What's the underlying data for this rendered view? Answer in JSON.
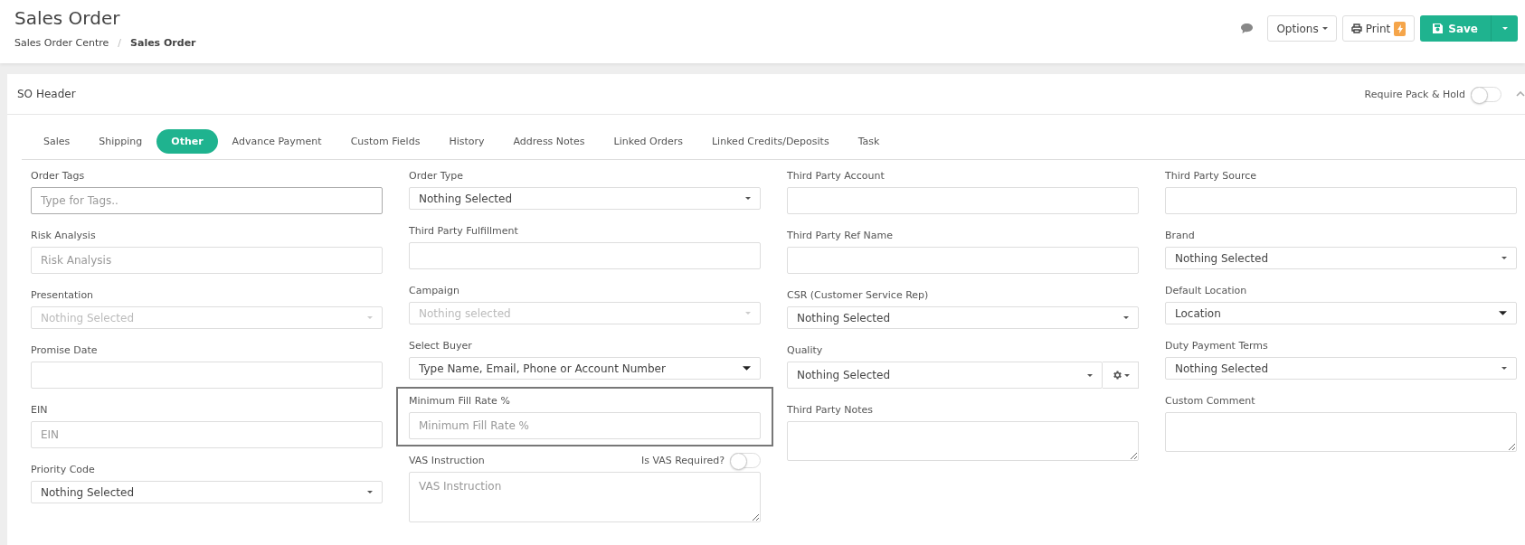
{
  "page": {
    "title": "Sales Order",
    "breadcrumb": [
      {
        "label": "Sales Order Centre",
        "current": false
      },
      {
        "label": "Sales Order",
        "current": true
      }
    ],
    "separator": "/"
  },
  "actions": {
    "options": "Options",
    "print": "Print",
    "save": "Save"
  },
  "panel": {
    "title": "SO Header",
    "toggle": {
      "label": "Require Pack & Hold",
      "on": false
    }
  },
  "tabs": [
    {
      "label": "Sales",
      "selected": false
    },
    {
      "label": "Shipping",
      "selected": false
    },
    {
      "label": "Other",
      "selected": true
    },
    {
      "label": "Advance Payment",
      "selected": false
    },
    {
      "label": "Custom Fields",
      "selected": false
    },
    {
      "label": "History",
      "selected": false
    },
    {
      "label": "Address Notes",
      "selected": false
    },
    {
      "label": "Linked Orders",
      "selected": false
    },
    {
      "label": "Linked Credits/Deposits",
      "selected": false
    },
    {
      "label": "Task",
      "selected": false
    }
  ],
  "columns": [
    [
      {
        "kind": "tags",
        "label": "Order Tags",
        "placeholder": "Type for Tags..",
        "disabled": false,
        "highlighted": false
      },
      {
        "kind": "text",
        "label": "Risk Analysis",
        "placeholder": "Risk Analysis",
        "disabled": false,
        "highlighted": false
      },
      {
        "kind": "select",
        "label": "Presentation",
        "value": "Nothing Selected",
        "disabled": true,
        "highlighted": false
      },
      {
        "kind": "text",
        "label": "Promise Date",
        "disabled": false,
        "highlighted": false
      },
      {
        "kind": "text",
        "label": "EIN",
        "placeholder": "EIN",
        "disabled": false,
        "highlighted": false
      },
      {
        "kind": "select",
        "label": "Priority Code",
        "value": "Nothing Selected",
        "disabled": false,
        "highlighted": false
      }
    ],
    [
      {
        "kind": "select",
        "label": "Order Type",
        "value": "Nothing Selected",
        "disabled": false,
        "highlighted": false
      },
      {
        "kind": "text",
        "label": "Third Party Fulfillment",
        "disabled": false,
        "highlighted": false
      },
      {
        "kind": "select",
        "label": "Campaign",
        "value": "Nothing selected",
        "disabled": true,
        "highlighted": false
      },
      {
        "kind": "combobox",
        "label": "Select Buyer",
        "value": "Type Name, Email, Phone or Account Number",
        "disabled": false,
        "highlighted": false
      },
      {
        "kind": "text",
        "label": "Minimum Fill Rate %",
        "placeholder": "Minimum Fill Rate %",
        "disabled": false,
        "highlighted": true
      },
      {
        "kind": "textarea",
        "label": "VAS Instruction",
        "placeholder": "VAS Instruction",
        "disabled": false,
        "highlighted": false,
        "toggle": {
          "label": "Is VAS Required?",
          "on": false
        }
      }
    ],
    [
      {
        "kind": "text",
        "label": "Third Party Account",
        "disabled": false,
        "highlighted": false
      },
      {
        "kind": "text",
        "label": "Third Party Ref Name",
        "disabled": false,
        "highlighted": false
      },
      {
        "kind": "select",
        "label": "CSR (Customer Service Rep)",
        "value": "Nothing Selected",
        "disabled": false,
        "highlighted": false
      },
      {
        "kind": "select-gear",
        "label": "Quality",
        "value": "Nothing Selected",
        "disabled": false,
        "highlighted": false
      },
      {
        "kind": "note",
        "label": "Third Party Notes",
        "disabled": false,
        "highlighted": false
      }
    ],
    [
      {
        "kind": "text",
        "label": "Third Party Source",
        "disabled": false,
        "highlighted": false
      },
      {
        "kind": "select",
        "label": "Brand",
        "value": "Nothing Selected",
        "disabled": false,
        "highlighted": false
      },
      {
        "kind": "combobox",
        "label": "Default Location",
        "value": "Location",
        "disabled": false,
        "highlighted": false
      },
      {
        "kind": "select",
        "label": "Duty Payment Terms",
        "value": "Nothing Selected",
        "disabled": false,
        "highlighted": false
      },
      {
        "kind": "note",
        "label": "Custom Comment",
        "disabled": false,
        "highlighted": false
      }
    ]
  ]
}
